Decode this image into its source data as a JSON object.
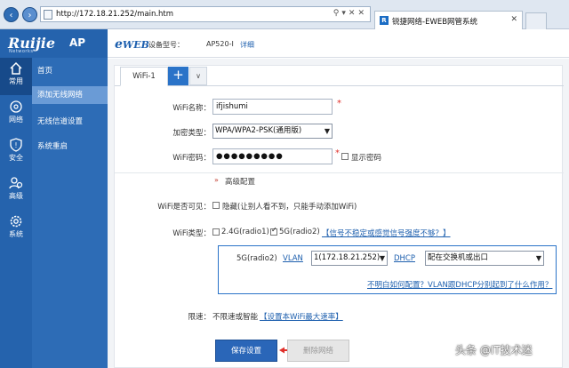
{
  "browser": {
    "url": "http://172.18.21.252/main.htm",
    "tab_title": "锐捷网络-EWEB网管系统",
    "back_icon": "arrow-left-icon",
    "forward_icon": "arrow-right-icon"
  },
  "header": {
    "brand": "Ruijie",
    "brand_sub": "Networks",
    "product": "AP",
    "eweb": "EWEB",
    "device_label": "设备型号：",
    "device_model": "AP520-I",
    "detail_link": "详细"
  },
  "sidebar": {
    "icons": [
      {
        "label": "常用",
        "icon": "home-icon"
      },
      {
        "label": "网络",
        "icon": "globe-icon"
      },
      {
        "label": "安全",
        "icon": "shield-icon"
      },
      {
        "label": "高级",
        "icon": "users-icon"
      },
      {
        "label": "系统",
        "icon": "gear-icon"
      }
    ],
    "items": [
      {
        "label": "首页"
      },
      {
        "label": "添加无线网络"
      },
      {
        "label": "无线信道设置"
      },
      {
        "label": "系统重启"
      }
    ]
  },
  "tabs": {
    "active": "WiFi-1",
    "add": "+",
    "dropdown": "∨"
  },
  "form": {
    "ssid_label": "WiFi名称：",
    "ssid_value": "ifjishumi",
    "enc_label": "加密类型：",
    "enc_value": "WPA/WPA2-PSK(通用版)",
    "pwd_label": "WiFi密码：",
    "pwd_value": "●●●●●●●●●",
    "show_pwd": "显示密码",
    "required": "*",
    "advanced_toggle": "高级配置",
    "visible_label": "WiFi是否可见：",
    "hidden_text": "隐藏(让别人看不到，只能手动添加WiFi)",
    "type_label": "WiFi类型：",
    "type_24g": "2.4G(radio1)",
    "type_5g": "5G(radio2)",
    "type_help": "【信号不稳定或感觉信号强度不够？】",
    "radio_label": "5G(radio2)",
    "vlan_link": "VLAN",
    "vlan_value": "1(172.18.21.252)",
    "dhcp_link": "DHCP",
    "dhcp_value": "配在交换机或出口",
    "vlan_help": "不明白如何配置？VLAN跟DHCP分别起到了什么作用？",
    "limit_label": "限速：",
    "limit_value": "不限速或智能",
    "limit_link": "【设置本WiFi最大速率】",
    "save_button": "保存设置",
    "delete_button": "删除网络"
  },
  "watermark": "头条 @IT技术迷",
  "colors": {
    "brand": "#2563ad",
    "accent": "#2a73c8",
    "required": "#e0302b",
    "arrow": "#e0302b"
  }
}
